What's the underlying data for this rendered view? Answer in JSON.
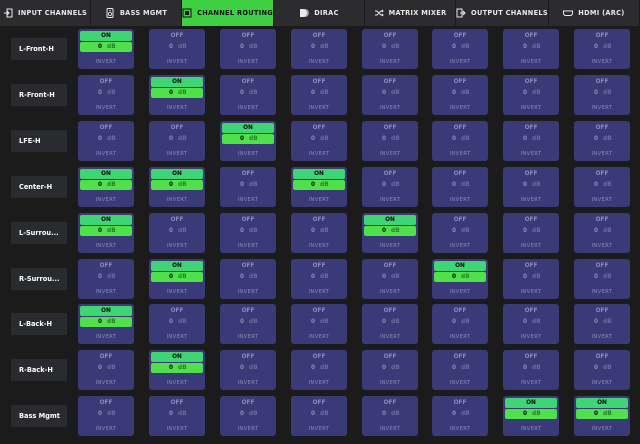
{
  "nav": {
    "tabs": [
      {
        "label": "INPUT CHANNELS",
        "icon": "input-icon",
        "active": false
      },
      {
        "label": "BASS MGMT",
        "icon": "speaker-icon",
        "active": false
      },
      {
        "label": "CHANNEL ROUTING",
        "icon": "routing-icon",
        "active": true
      },
      {
        "label": "DIRAC",
        "icon": "dirac-icon",
        "active": false
      },
      {
        "label": "MATRIX MIXER",
        "icon": "shuffle-icon",
        "active": false
      },
      {
        "label": "OUTPUT CHANNELS",
        "icon": "output-icon",
        "active": false
      },
      {
        "label": "HDMI (ARC)",
        "icon": "hdmi-icon",
        "active": false
      }
    ]
  },
  "labels": {
    "on": "ON",
    "off": "OFF",
    "gain": "0",
    "unit": "dB",
    "invert": "INVERT"
  },
  "rows": [
    {
      "label": "L-Front-H",
      "on": [
        true,
        false,
        false,
        false,
        false,
        false,
        false,
        false
      ]
    },
    {
      "label": "R-Front-H",
      "on": [
        false,
        true,
        false,
        false,
        false,
        false,
        false,
        false
      ]
    },
    {
      "label": "LFE-H",
      "on": [
        false,
        false,
        true,
        false,
        false,
        false,
        false,
        false
      ]
    },
    {
      "label": "Center-H",
      "on": [
        true,
        true,
        false,
        true,
        false,
        false,
        false,
        false
      ]
    },
    {
      "label": "L-Surrou...",
      "on": [
        true,
        false,
        false,
        false,
        true,
        false,
        false,
        false
      ]
    },
    {
      "label": "R-Surrou...",
      "on": [
        false,
        true,
        false,
        false,
        false,
        true,
        false,
        false
      ]
    },
    {
      "label": "L-Back-H",
      "on": [
        true,
        false,
        false,
        false,
        false,
        false,
        false,
        false
      ]
    },
    {
      "label": "R-Back-H",
      "on": [
        false,
        true,
        false,
        false,
        false,
        false,
        false,
        false
      ]
    },
    {
      "label": "Bass Mgmt",
      "on": [
        false,
        false,
        false,
        false,
        false,
        false,
        true,
        true
      ]
    }
  ],
  "colors": {
    "cell_bg": "#3a3a79",
    "on_green": "#3fd574",
    "value_green": "#4fe04b",
    "active_tab": "#3ecf43"
  }
}
